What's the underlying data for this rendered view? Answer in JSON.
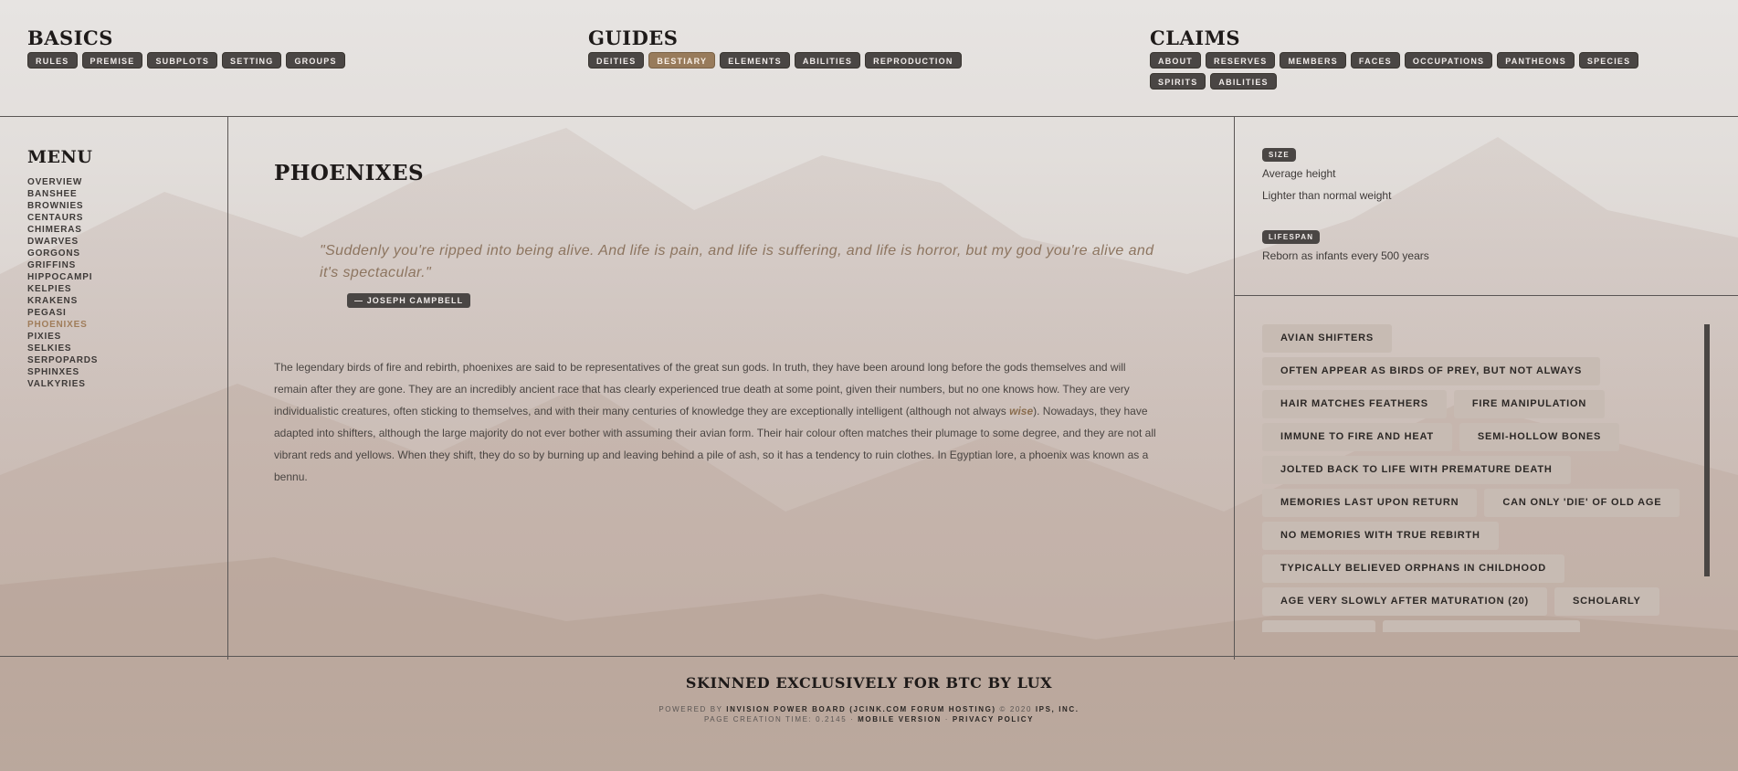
{
  "header": {
    "basics": {
      "title": "BASICS",
      "items": [
        "RULES",
        "PREMISE",
        "SUBPLOTS",
        "SETTING",
        "GROUPS"
      ]
    },
    "guides": {
      "title": "GUIDES",
      "items": [
        "DEITIES",
        "BESTIARY",
        "ELEMENTS",
        "ABILITIES",
        "REPRODUCTION"
      ],
      "active": "BESTIARY"
    },
    "claims": {
      "title": "CLAIMS",
      "items": [
        "ABOUT",
        "RESERVES",
        "MEMBERS",
        "FACES",
        "OCCUPATIONS",
        "PANTHEONS",
        "SPECIES",
        "SPIRITS",
        "ABILITIES"
      ]
    }
  },
  "menu": {
    "title": "MENU",
    "items": [
      "OVERVIEW",
      "BANSHEE",
      "BROWNIES",
      "CENTAURS",
      "CHIMERAS",
      "DWARVES",
      "GORGONS",
      "GRIFFINS",
      "HIPPOCAMPI",
      "KELPIES",
      "KRAKENS",
      "PEGASI",
      "PHOENIXES",
      "PIXIES",
      "SELKIES",
      "SERPOPARDS",
      "SPHINXES",
      "VALKYRIES"
    ],
    "active": "PHOENIXES"
  },
  "main": {
    "title": "PHOENIXES",
    "quote": "\"Suddenly you're ripped into being alive. And life is pain, and life is suffering, and life is horror, but my god you're alive and it's spectacular.\"",
    "quote_author": "— JOSEPH CAMPBELL",
    "body_before": "The legendary birds of fire and rebirth, phoenixes are said to be representatives of the great sun gods. In truth, they have been around long before the gods themselves and will remain after they are gone. They are an incredibly ancient race that has clearly experienced true death at some point, given their numbers, but no one knows how. They are very individualistic creatures, often sticking to themselves, and with their many centuries of knowledge they are exceptionally intelligent (although not always ",
    "body_emph": "wise",
    "body_after": "). Nowadays, they have adapted into shifters, although the large majority do not ever bother with assuming their avian form. Their hair colour often matches their plumage to some degree, and they are not all vibrant reds and yellows. When they shift, they do so by burning up and leaving behind a pile of ash, so it has a tendency to ruin clothes. In Egyptian lore, a phoenix was known as a bennu."
  },
  "stats": {
    "size_label": "SIZE",
    "size_lines": [
      "Average height",
      "Lighter than normal weight"
    ],
    "lifespan_label": "LIFESPAN",
    "lifespan_lines": [
      "Reborn as infants every 500 years"
    ]
  },
  "traits": [
    [
      "AVIAN SHIFTERS"
    ],
    [
      "OFTEN APPEAR AS BIRDS OF PREY, BUT NOT ALWAYS"
    ],
    [
      "HAIR MATCHES FEATHERS",
      "FIRE MANIPULATION"
    ],
    [
      "IMMUNE TO FIRE AND HEAT",
      "SEMI-HOLLOW BONES"
    ],
    [
      "JOLTED BACK TO LIFE WITH PREMATURE DEATH"
    ],
    [
      "MEMORIES LAST UPON RETURN",
      "CAN ONLY 'DIE' OF OLD AGE"
    ],
    [
      "NO MEMORIES WITH TRUE REBIRTH"
    ],
    [
      "TYPICALLY BELIEVED ORPHANS IN CHILDHOOD"
    ],
    [
      "AGE VERY SLOWLY AFTER MATURATION (20)",
      "SCHOLARLY"
    ],
    [
      "",
      ""
    ]
  ],
  "footer": {
    "title": "SKINNED EXCLUSIVELY FOR BTC BY LUX",
    "powered_prefix": "POWERED BY ",
    "powered_link": "INVISION POWER BOARD (JCINK.COM FORUM HOSTING)",
    "copyright": " © 2020 ",
    "company": "IPS, INC.",
    "page_time": "PAGE CREATION TIME: 0.2145 · ",
    "mobile": "MOBILE VERSION",
    "sep": " · ",
    "privacy": "PRIVACY POLICY"
  }
}
